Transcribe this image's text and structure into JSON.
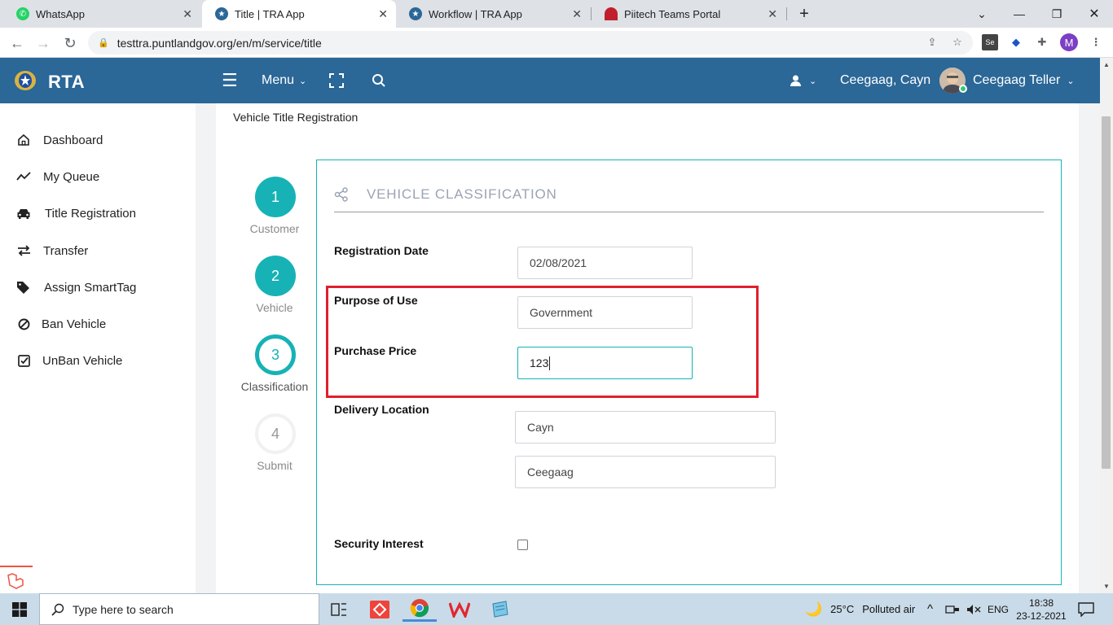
{
  "browser": {
    "tabs": [
      {
        "label": "WhatsApp",
        "active": false
      },
      {
        "label": "Title | TRA App",
        "active": true
      },
      {
        "label": "Workflow | TRA App",
        "active": false
      },
      {
        "label": "Piitech Teams Portal",
        "active": false
      }
    ],
    "url": "testtra.puntlandgov.org/en/m/service/title",
    "profile_initial": "M"
  },
  "header": {
    "brand": "RTA",
    "menu_label": "Menu",
    "location": "Ceegaag, Cayn",
    "user_name": "Ceegaag Teller"
  },
  "sidebar": {
    "items": [
      {
        "label": "Dashboard",
        "icon": "home-icon"
      },
      {
        "label": "My Queue",
        "icon": "trend-line-icon"
      },
      {
        "label": "Title Registration",
        "icon": "car-icon"
      },
      {
        "label": "Transfer",
        "icon": "exchange-arrows-icon"
      },
      {
        "label": "Assign SmartTag",
        "icon": "tags-icon"
      },
      {
        "label": "Ban Vehicle",
        "icon": "ban-icon"
      },
      {
        "label": "UnBan Vehicle",
        "icon": "check-square-icon"
      }
    ]
  },
  "page": {
    "title": "Vehicle Title Registration"
  },
  "steps": [
    {
      "number": "1",
      "label": "Customer",
      "state": "done"
    },
    {
      "number": "2",
      "label": "Vehicle",
      "state": "done"
    },
    {
      "number": "3",
      "label": "Classification",
      "state": "current"
    },
    {
      "number": "4",
      "label": "Submit",
      "state": "todo"
    }
  ],
  "form": {
    "section_title": "VEHICLE CLASSIFICATION",
    "registration_date": {
      "label": "Registration Date",
      "value": "02/08/2021"
    },
    "purpose_of_use": {
      "label": "Purpose of Use",
      "value": "Government"
    },
    "purchase_price": {
      "label": "Purchase Price",
      "value": "123"
    },
    "delivery_location": {
      "label": "Delivery Location",
      "region": "Cayn",
      "district": "Ceegaag"
    },
    "security_interest": {
      "label": "Security Interest",
      "checked": false
    }
  },
  "taskbar": {
    "search_placeholder": "Type here to search",
    "weather": "25°C",
    "air": "Polluted air",
    "language": "ENG",
    "time": "18:38",
    "date": "23-12-2021"
  },
  "colors": {
    "header_bg": "#2b6797",
    "teal": "#17b2b5",
    "highlight_red": "#e0202d"
  }
}
